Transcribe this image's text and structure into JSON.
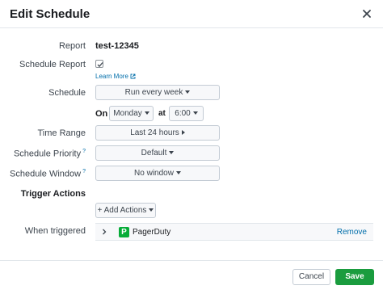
{
  "dialog": {
    "title": "Edit Schedule"
  },
  "fields": {
    "report_label": "Report",
    "report_value": "test-12345",
    "schedule_report_label": "Schedule Report",
    "schedule_report_checked": true,
    "learn_more": "Learn More",
    "schedule_label": "Schedule",
    "schedule_value": "Run every week",
    "on_label": "On",
    "day_value": "Monday",
    "at_label": "at",
    "time_value": "6:00",
    "time_range_label": "Time Range",
    "time_range_value": "Last 24 hours",
    "priority_label": "Schedule Priority",
    "priority_help": "?",
    "priority_value": "Default",
    "window_label": "Schedule Window",
    "window_help": "?",
    "window_value": "No window"
  },
  "trigger": {
    "heading": "Trigger Actions",
    "add_actions": "+ Add Actions",
    "when_triggered_label": "When triggered",
    "action_logo": "P",
    "action_name": "PagerDuty",
    "remove": "Remove"
  },
  "footer": {
    "cancel": "Cancel",
    "save": "Save"
  },
  "colors": {
    "primary_button": "#1a9c3e",
    "link": "#006eaa",
    "pagerduty": "#06ac38"
  },
  "icons": [
    "close-icon",
    "checkmark-icon",
    "external-link-icon",
    "chevron-down-icon",
    "chevron-right-icon",
    "pagerduty-logo"
  ]
}
